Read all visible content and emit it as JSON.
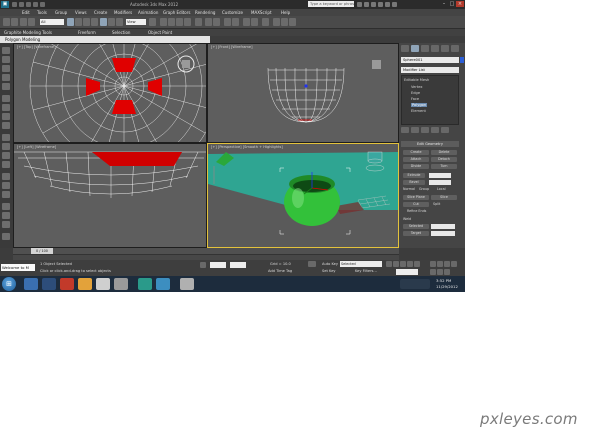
{
  "window": {
    "title": "Autodesk 3ds Max 2012",
    "search_placeholder": "Type a keyword or phrase"
  },
  "menu": [
    "Edit",
    "Tools",
    "Group",
    "Views",
    "Create",
    "Modifiers",
    "Animation",
    "Graph Editors",
    "Rendering",
    "Customize",
    "MAXScript",
    "Help"
  ],
  "toolbar": {
    "selection_filter": "All",
    "reference_coord": "View"
  },
  "ribbon": {
    "tabs": [
      "Graphite Modeling Tools",
      "Freeform",
      "Selection",
      "Object Paint"
    ],
    "panel": "Polygon Modeling"
  },
  "viewports": {
    "top": "[+] [Top] [Wireframe]",
    "front": "[+] [Front] [Wireframe]",
    "left": "[+] [Left] [Wireframe]",
    "perspective": "[+] [Perspective] [Smooth + Highlights]"
  },
  "command_panel": {
    "object_name": "Sphere001",
    "modifier_list": "Modifier List",
    "stack": [
      "Editable Mesh",
      "Vertex",
      "Edge",
      "Face",
      "Polygon",
      "Element"
    ],
    "selected_stack_item": "Polygon",
    "rollout_title": "Edit Geometry",
    "buttons": {
      "create": "Create",
      "delete": "Delete",
      "attach": "Attach",
      "detach": "Detach",
      "divide": "Divide",
      "turn": "Turn",
      "extrude": "Extrude",
      "bevel": "Bevel",
      "normal": "Normal",
      "group": "Group",
      "local": "Local",
      "slice_plane": "Slice Plane",
      "slice": "Slice",
      "cut": "Cut",
      "split": "Split",
      "refine_ends": "Refine Ends",
      "weld": "Weld",
      "selected": "Selected",
      "target": "Target"
    }
  },
  "timeline": {
    "slider": "0 / 100"
  },
  "status": {
    "welcome": "Welcome to M",
    "selection": "1 Object Selected",
    "hint": "Click or click-and-drag to select objects",
    "grid": "Grid = 10.0",
    "add_time_tag": "Add Time Tag",
    "auto_key": "Auto Key",
    "auto_key_mode": "Selected",
    "set_key": "Set Key",
    "key_filters": "Key Filters..."
  },
  "taskbar": {
    "time": "3:52 PM",
    "date": "11/29/2012"
  },
  "watermark": "pxleyes.com",
  "colors": {
    "viewport_bg": "#5e5e5e",
    "wireframe": "#ffffff",
    "selected_faces": "#e00000",
    "floor_plane": "#2fa592",
    "sphere": "#33c13a",
    "active_border": "#e3c23c"
  }
}
